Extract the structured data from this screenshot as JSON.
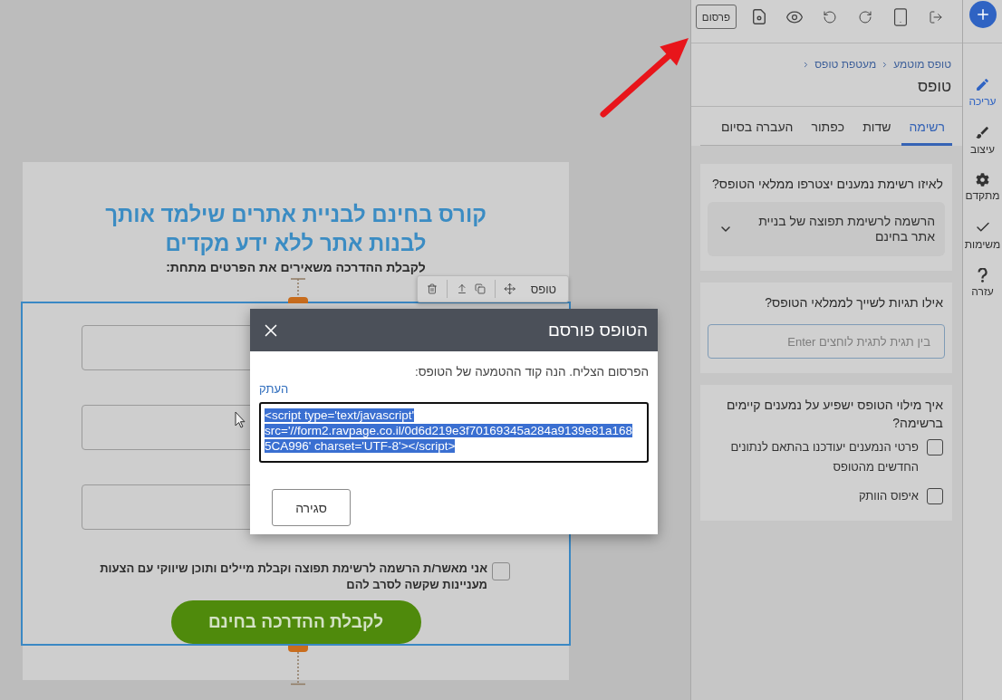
{
  "canvas": {
    "form": {
      "title_lines": [
        "קורס בחינם לבניית אתרים שילמד אותך",
        "לבנות אתר ללא ידע מקדים"
      ],
      "subtitle": "לקבלת ההדרכה משאירים את הפרטים מתחת:",
      "fields": [
        {
          "kind": "text_input"
        },
        {
          "kind": "text_input"
        },
        {
          "kind": "text_input"
        }
      ],
      "consent": {
        "text": "אני מאשר/ת הרשמה לרשימת תפוצה וקבלת מיילים ותוכן שיווקי עם הצעות מעניינות שקשה לסרב להם",
        "checked": false
      },
      "submit_button": "לקבלת ההדרכה בחינם"
    },
    "element_toolbar": {
      "label": "טופס"
    }
  },
  "dialog": {
    "title": "הטופס פורסם",
    "message": "הפרסום הצליח. הנה קוד ההטמעה של הטופס:",
    "copy_link": "העתק",
    "embed_code": {
      "value": "<script type='text/javascript' src='//form2.ravpage.co.il/0d6d219e3f70169345a284a9139e81a1685CA996' charset='UTF-8'></script>",
      "selected": true
    },
    "close_button": "סגירה"
  },
  "editor": {
    "toolbar": {
      "publish_button": "פרסום"
    },
    "breadcrumb": [
      "טופס מוטמע",
      "מעטפת טופס"
    ],
    "heading": "טופס",
    "tabs": [
      {
        "label": "רשימה",
        "selected": true
      },
      {
        "label": "שדות",
        "selected": false
      },
      {
        "label": "כפתור",
        "selected": false
      },
      {
        "label": "העברה בסיום",
        "selected": false
      }
    ],
    "cards": [
      {
        "kind": "select",
        "question": "לאיזו רשימת נמענים יצטרפו ממלאי הטופס?",
        "value": "הרשמה לרשימת תפוצה של בניית אתר בחינם"
      },
      {
        "kind": "tags",
        "question": "אילו תגיות לשייך לממלאי הטופס?",
        "placeholder": "בין תגית לתגית לוחצים Enter"
      },
      {
        "kind": "options",
        "question": "איך מילוי הטופס ישפיע על נמענים קיימים ברשימה?",
        "options": [
          {
            "label": "פרטי הנמענים יעודכנו בהתאם לנתונים החדשים מהטופס",
            "checked": false
          },
          {
            "label": "איפוס הוותק",
            "checked": false
          }
        ]
      }
    ]
  },
  "rail": {
    "items": [
      {
        "label": "עריכה",
        "selected": true
      },
      {
        "label": "עיצוב",
        "selected": false
      },
      {
        "label": "מתקדם",
        "selected": false
      },
      {
        "label": "משימות",
        "selected": false
      },
      {
        "label": "עזרה",
        "selected": false
      }
    ]
  }
}
